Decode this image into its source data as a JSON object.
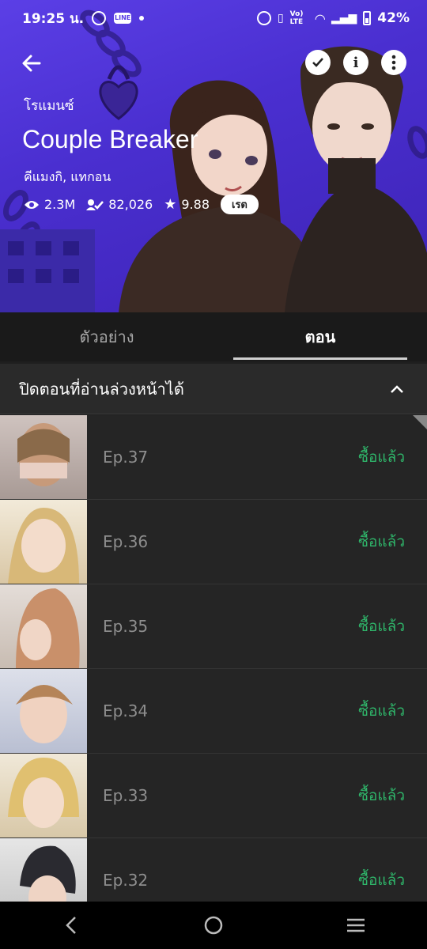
{
  "status_bar": {
    "time": "19:25 น.",
    "battery": "42%",
    "network_badge": "Vo) LTE"
  },
  "header": {
    "genre": "โรแมนซ์",
    "title": "Couple Breaker",
    "author": "คีแมงกิ, แทกอน",
    "stats": {
      "views": "2.3M",
      "subscribers": "82,026",
      "rating": "9.88",
      "rate_button": "เรต"
    },
    "icons": [
      "back-arrow-icon",
      "check-icon",
      "info-icon",
      "more-vertical-icon"
    ]
  },
  "tabs": [
    {
      "label": "ตัวอย่าง",
      "active": false
    },
    {
      "label": "ตอน",
      "active": true
    }
  ],
  "section": {
    "label": "ปิดตอนที่อ่านล่วงหน้าได้"
  },
  "episodes": [
    {
      "label": "Ep.37",
      "status": "ซื้อแล้ว"
    },
    {
      "label": "Ep.36",
      "status": "ซื้อแล้ว"
    },
    {
      "label": "Ep.35",
      "status": "ซื้อแล้ว"
    },
    {
      "label": "Ep.34",
      "status": "ซื้อแล้ว"
    },
    {
      "label": "Ep.33",
      "status": "ซื้อแล้ว"
    },
    {
      "label": "Ep.32",
      "status": "ซื้อแล้ว"
    }
  ],
  "colors": {
    "hero_bg": "#4a2fd0",
    "purchased_green": "#2fb56a",
    "list_bg": "#252525"
  }
}
